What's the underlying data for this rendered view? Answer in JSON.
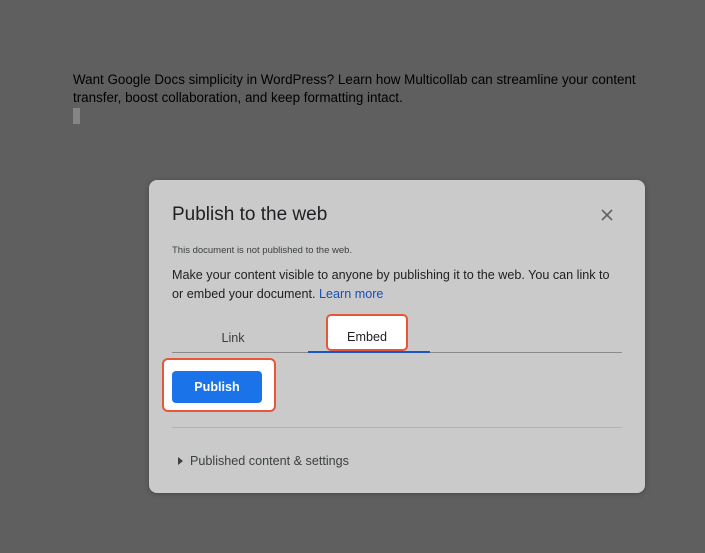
{
  "document": {
    "body_text": "Want Google Docs simplicity in WordPress? Learn how Multicollab can streamline your content transfer, boost collaboration, and keep formatting intact."
  },
  "dialog": {
    "title": "Publish to the web",
    "close_icon": "close-icon",
    "status": "This document is not published to the web.",
    "description": "Make your content visible to anyone by publishing it to the web. You can link to or embed your document.",
    "learn_more": "Learn more",
    "tabs": [
      {
        "label": "Link",
        "active": false
      },
      {
        "label": "Embed",
        "active": true
      }
    ],
    "publish_label": "Publish",
    "settings_label": "Published content & settings",
    "settings_icon": "caret-right-icon"
  },
  "colors": {
    "overlay": "#5f5f5f",
    "dialog_bg": "#cacaca",
    "primary_button": "#1a73e8",
    "highlight_border": "#e8563a",
    "link": "#1a4fb8"
  }
}
